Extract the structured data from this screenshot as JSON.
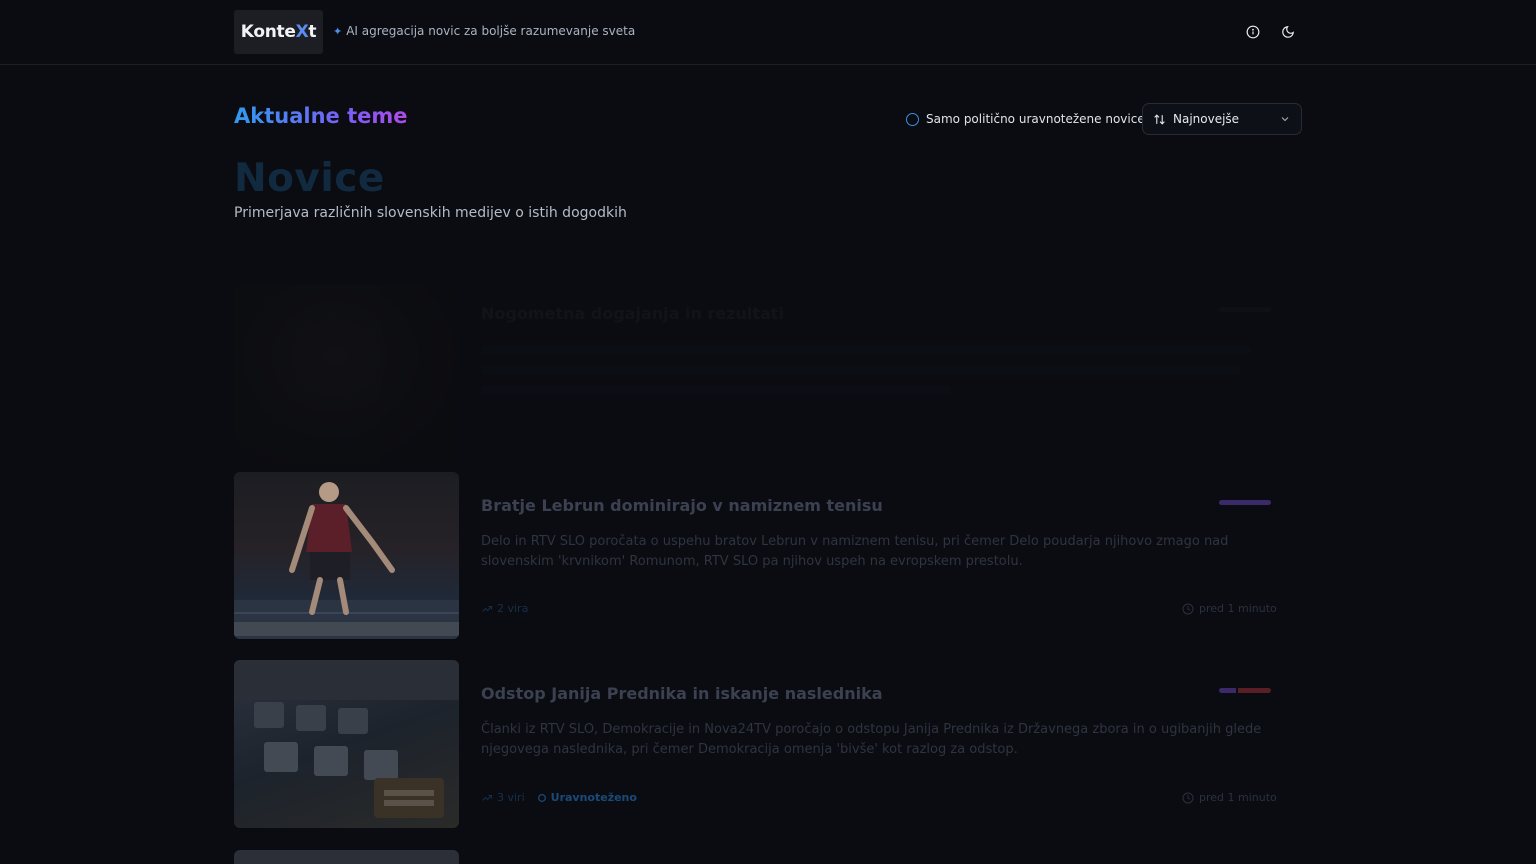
{
  "header": {
    "logo_text": "Konte",
    "logo_x": "X",
    "logo_t": "t",
    "tagline": "AI agregacija novic za boljše razumevanje sveta",
    "icons": [
      "info-icon",
      "moon-icon"
    ]
  },
  "toolbar": {
    "section_title": "Aktualne teme",
    "balanced_toggle_label": "Samo politično uravnotežene novice",
    "sort_label": "Najnovejše"
  },
  "hero": {
    "title": "Novice",
    "subtitle": "Primerjava različnih slovenskih medijev o istih dogodkih"
  },
  "articles": [
    {
      "title": "Nogometna dogajanja in rezultati",
      "description": "",
      "sources": "",
      "time": ""
    },
    {
      "title": "Bratje Lebrun dominirajo v namiznem tenisu",
      "description": "Delo in RTV SLO poročata o uspehu bratov Lebrun v namiznem tenisu, pri čemer Delo poudarja njihovo zmago nad slovenskim 'krvnikom' Romunom, RTV SLO pa njihov uspeh na evropskem prestolu.",
      "sources": "2 vira",
      "balanced": "",
      "time": "pred 1 minuto",
      "bar_colors": [
        "#3a2a6a"
      ]
    },
    {
      "title": "Odstop Janija Prednika in iskanje naslednika",
      "description": "Članki iz RTV SLO, Demokracije in Nova24TV poročajo o odstopu Janija Prednika iz Državnega zbora in o ugibanjih glede njegovega naslednika, pri čemer Demokracija omenja 'bivše' kot razlog za odstop.",
      "sources": "3 viri",
      "balanced": "Uravnoteženo",
      "time": "pred 1 minuto",
      "bar_colors": [
        "#3a2a6a",
        "#5a1f26"
      ]
    }
  ]
}
